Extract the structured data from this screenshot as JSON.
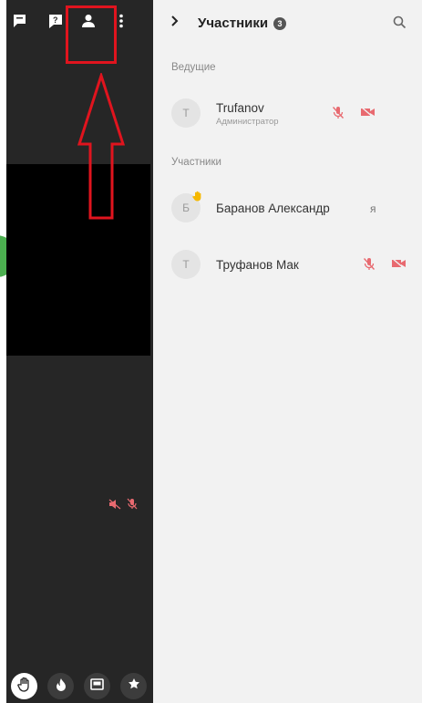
{
  "colors": {
    "sidebar_bg": "#262626",
    "panel_bg": "#f2f2f2",
    "annotation": "#e0141e",
    "muted_icon": "#e86a70",
    "avatar_green": "#4caf50"
  },
  "toolbar": {
    "icons": [
      "chat-icon",
      "help-icon",
      "participants-icon",
      "more-vertical-icon"
    ]
  },
  "bottom_bar": {
    "icons": [
      "raise-hand-icon",
      "flame-icon",
      "picture-in-picture-icon",
      "star-icon"
    ]
  },
  "panel": {
    "title": "Участники",
    "count": "3",
    "sections": {
      "hosts": "Ведущие",
      "participants": "Участники"
    }
  },
  "hosts": [
    {
      "initial": "T",
      "name": "Trufanov",
      "role": "Администратор",
      "mic_muted": true,
      "camera_off": true
    }
  ],
  "participants": [
    {
      "initial": "Б",
      "name": "Баранов Александр",
      "me_label": "я",
      "hand_raised": true
    },
    {
      "initial": "T",
      "name": "Труфанов Мак",
      "mic_muted": true,
      "camera_off": true
    }
  ]
}
